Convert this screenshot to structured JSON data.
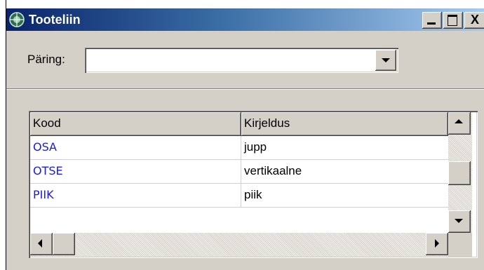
{
  "window": {
    "title": "Tooteliin",
    "icon": "globe-app-icon",
    "controls": [
      "minimize-icon",
      "maximize-icon",
      "close-icon"
    ],
    "close_glyph": "X"
  },
  "query": {
    "label": "Päring:",
    "value": ""
  },
  "grid": {
    "columns": [
      "Kood",
      "Kirjeldus"
    ],
    "rows": [
      {
        "kood": "OSA",
        "kirjeldus": "jupp"
      },
      {
        "kood": "OTSE",
        "kirjeldus": "vertikaalne"
      },
      {
        "kood": "PIIK",
        "kirjeldus": "piik"
      }
    ],
    "code_color": "#1a1ae6"
  }
}
